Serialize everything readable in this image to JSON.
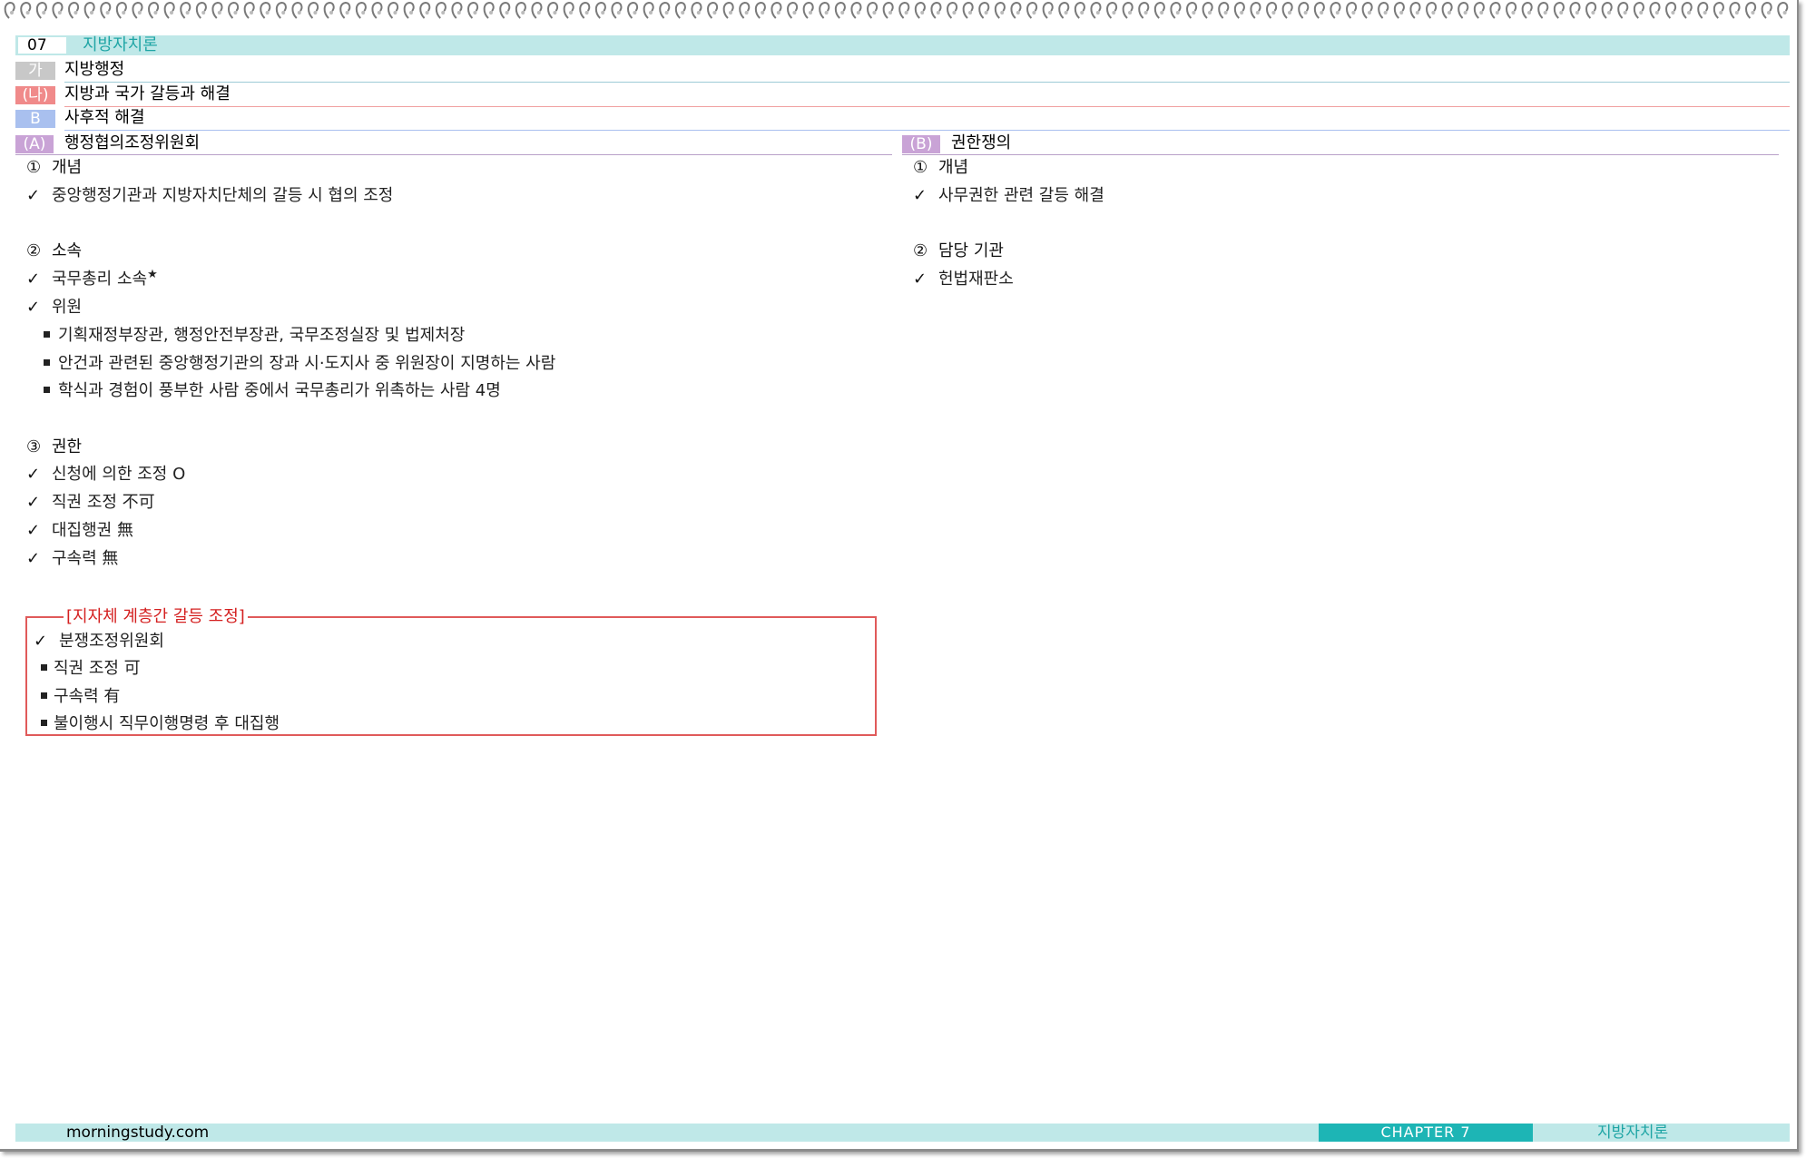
{
  "chapter": {
    "number": "07",
    "title": "지방자치론"
  },
  "headings": {
    "level1": {
      "tag": "가",
      "label": "지방행정"
    },
    "level2": {
      "tag": "(나)",
      "label": "지방과 국가 갈등과 해결"
    },
    "level3": {
      "tag": "B",
      "label": "사후적 해결"
    }
  },
  "left": {
    "tag": "(A)",
    "title": "행정협의조정위원회",
    "s1": {
      "num": "①",
      "title": "개념",
      "items": [
        "중앙행정기관과 지방자치단체의 갈등 시 협의 조정"
      ]
    },
    "s2": {
      "num": "②",
      "title": "소속",
      "item1": "국무총리 소속",
      "star": "★",
      "item2": "위원",
      "subs": [
        "기획재정부장관, 행정안전부장관, 국무조정실장 및 법제처장",
        "안건과 관련된 중앙행정기관의 장과 시·도지사 중 위원장이 지명하는 사람",
        "학식과 경험이 풍부한 사람 중에서 국무총리가 위촉하는 사람 4명"
      ]
    },
    "s3": {
      "num": "③",
      "title": "권한",
      "items": [
        "신청에 의한 조정 O",
        "직권 조정 不可",
        "대집행권 無",
        "구속력 無"
      ]
    },
    "box": {
      "title": "[지자체 계층간 갈등 조정]",
      "item": "분쟁조정위원회",
      "subs": [
        "직권 조정 可",
        "구속력 有",
        "불이행시 직무이행명령 후 대집행"
      ]
    }
  },
  "right": {
    "tag": "(B)",
    "title": "권한쟁의",
    "s1": {
      "num": "①",
      "title": "개념",
      "items": [
        "사무권한 관련 갈등 해결"
      ]
    },
    "s2": {
      "num": "②",
      "title": "담당 기관",
      "items": [
        "헌법재판소"
      ]
    }
  },
  "check_mark": "✓",
  "footer": {
    "site": "morningstudy.com",
    "chapter": "CHAPTER 7",
    "title": "지방자치론"
  },
  "colors": {
    "teal_light": "#bfe8e8",
    "teal_dark": "#1db5b5",
    "tag_gray": "#c8c8c8",
    "tag_red": "#f08a8a",
    "tag_blue": "#a9c0ef",
    "tag_purple": "#c9a3d6",
    "box_red": "#e05a5a"
  }
}
